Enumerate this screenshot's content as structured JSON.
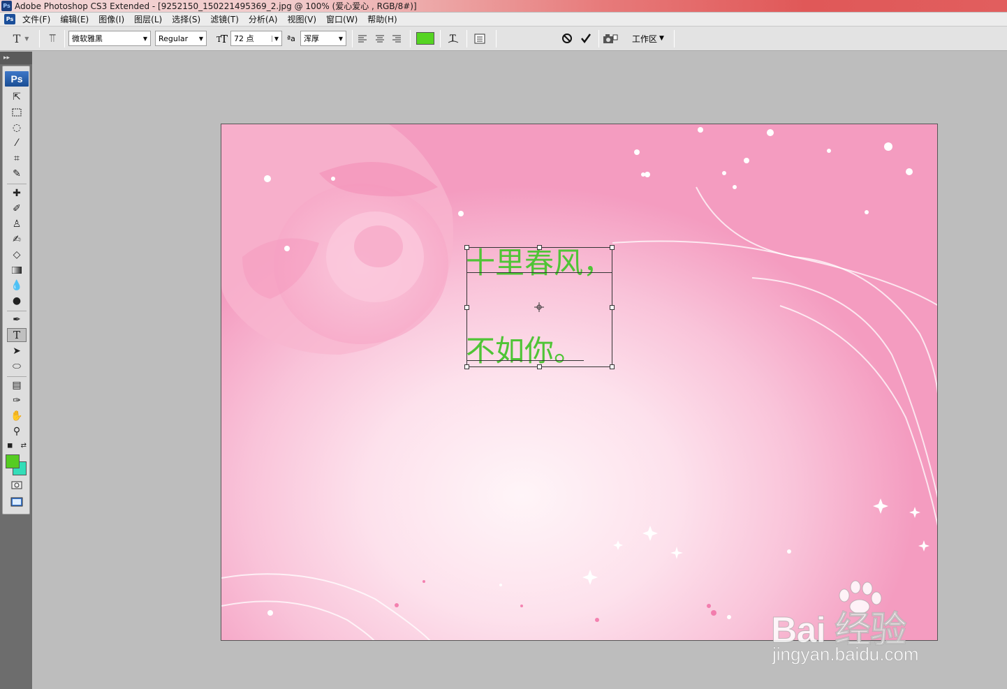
{
  "window": {
    "title": "Adobe Photoshop CS3 Extended - [9252150_150221495369_2.jpg @ 100% (爱心爱心 , RGB/8#)]"
  },
  "app_icon": "Ps",
  "menu": [
    "文件(F)",
    "编辑(E)",
    "图像(I)",
    "图层(L)",
    "选择(S)",
    "滤镜(T)",
    "分析(A)",
    "视图(V)",
    "窗口(W)",
    "帮助(H)"
  ],
  "options": {
    "font_family": "微软雅黑",
    "font_style": "Regular",
    "font_size": "72 点",
    "antialias_label": "ªa",
    "antialias": "浑厚",
    "text_color": "#55d422",
    "workspace": "工作区",
    "cancel_icon": "cancel-icon",
    "commit_icon": "checkmark-icon"
  },
  "tools": {
    "logo": "Ps",
    "foreground_color": "#55cc22",
    "background_color": "#33ddb8"
  },
  "document": {
    "text_lines": [
      "十里春风，",
      "不如你。"
    ],
    "text_color": "#4fc436"
  },
  "watermark": {
    "brand": "Bai  经验",
    "url": "jingyan.baidu.com"
  }
}
